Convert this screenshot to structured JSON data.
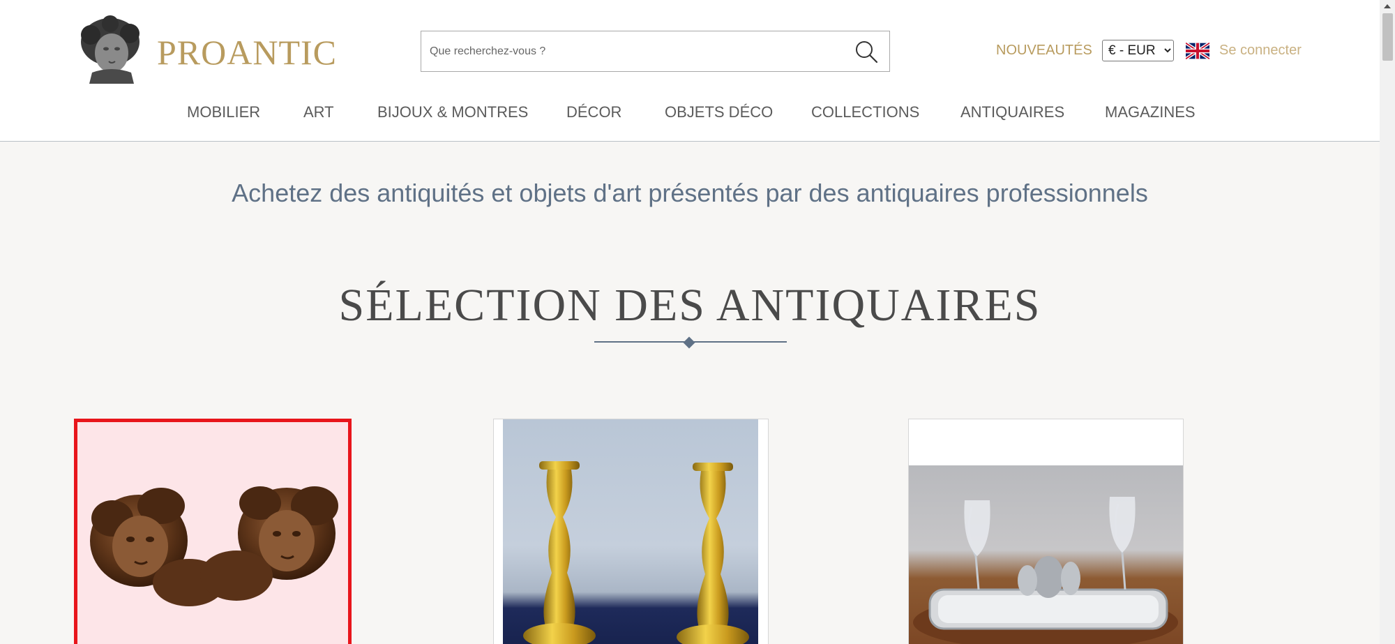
{
  "header": {
    "logo_text": "PROANTIC",
    "logo_icon": "cherub-bust-logo",
    "search": {
      "placeholder": "Que recherchez-vous ?",
      "value": "",
      "icon": "search-icon"
    },
    "nouveautes_label": "NOUVEAUTÉS",
    "currency": {
      "selected": "€ - EUR"
    },
    "language_flag": "uk-flag-icon",
    "login_label": "Se connecter"
  },
  "nav": {
    "items": [
      {
        "label": "MOBILIER"
      },
      {
        "label": "ART"
      },
      {
        "label": "BIJOUX & MONTRES"
      },
      {
        "label": "DÉCOR"
      },
      {
        "label": "OBJETS DÉCO"
      },
      {
        "label": "COLLECTIONS"
      },
      {
        "label": "ANTIQUAIRES"
      },
      {
        "label": "MAGAZINES"
      }
    ]
  },
  "main": {
    "tagline": "Achetez des antiquités et objets d'art présentés par des antiquaires professionnels",
    "section_title": "SÉLECTION DES ANTIQUAIRES",
    "cards": [
      {
        "subject": "carved wooden cherub heads",
        "selected": true
      },
      {
        "subject": "pair of gilt bronze candlesticks",
        "selected": false
      },
      {
        "subject": "silver mirrored table centerpiece with glass vases",
        "selected": false
      }
    ]
  },
  "colors": {
    "brand_gold": "#b89b5e",
    "tagline_blue": "#5f7186",
    "selection_red": "#e8151b",
    "page_background": "#f7f6f4"
  }
}
